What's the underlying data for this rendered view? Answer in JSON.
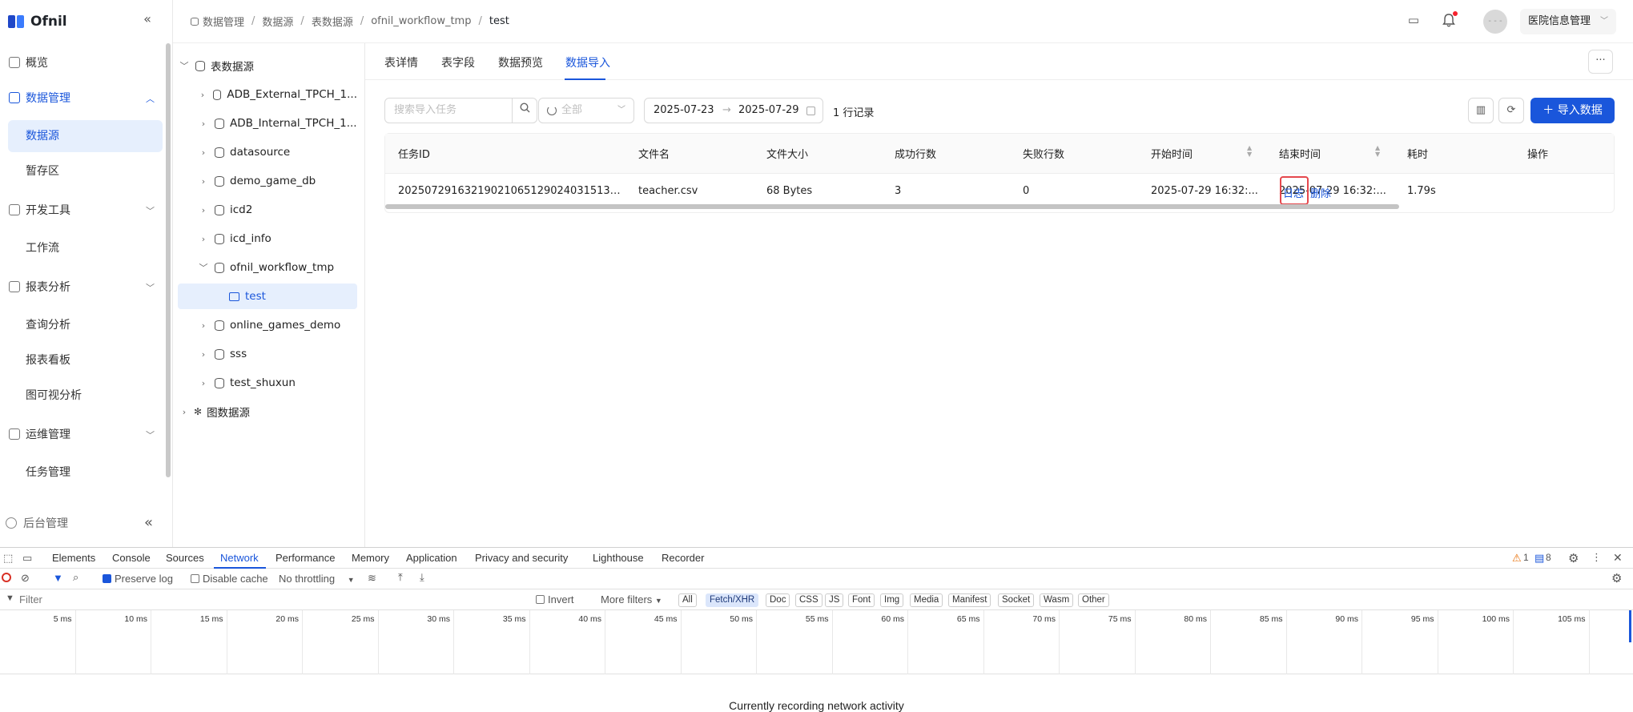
{
  "app": {
    "logo_text": "Ofnil"
  },
  "sidebar": {
    "items": [
      {
        "label": "概览"
      },
      {
        "label": "数据管理"
      },
      {
        "label": "数据源"
      },
      {
        "label": "暂存区"
      },
      {
        "label": "开发工具"
      },
      {
        "label": "工作流"
      },
      {
        "label": "报表分析"
      },
      {
        "label": "查询分析"
      },
      {
        "label": "报表看板"
      },
      {
        "label": "图可视分析"
      },
      {
        "label": "运维管理"
      },
      {
        "label": "任务管理"
      }
    ],
    "bottom_label": "后台管理"
  },
  "breadcrumb": [
    "数据管理",
    "数据源",
    "表数据源",
    "ofnil_workflow_tmp",
    "test"
  ],
  "header": {
    "org_name": "医院信息管理",
    "avatar_text": "- - -"
  },
  "tree": {
    "root": "表数据源",
    "children": [
      "ADB_External_TPCH_1...",
      "ADB_Internal_TPCH_1...",
      "datasource",
      "demo_game_db",
      "icd2",
      "icd_info",
      "ofnil_workflow_tmp",
      "test",
      "online_games_demo",
      "sss",
      "test_shuxun"
    ],
    "graph_root": "图数据源"
  },
  "tabs": [
    "表详情",
    "表字段",
    "数据预览",
    "数据导入"
  ],
  "toolbar": {
    "search_placeholder": "搜索导入任务",
    "status_placeholder": "全部",
    "date_start": "2025-07-23",
    "date_arrow": "→",
    "date_end": "2025-07-29",
    "record_count": "1 行记录",
    "import_label": "导入数据",
    "more_label": "···"
  },
  "table": {
    "columns": [
      "任务ID",
      "文件名",
      "文件大小",
      "成功行数",
      "失败行数",
      "开始时间",
      "结束时间",
      "耗时",
      "操作"
    ],
    "rows": [
      {
        "task_id": "20250729163219021065129024031513…",
        "file_name": "teacher.csv",
        "file_size": "68 Bytes",
        "success_rows": "3",
        "failed_rows": "0",
        "start_time": "2025-07-29 16:32:...",
        "end_time": "2025-07-29 16:32:...",
        "duration": "1.79s",
        "action_log": "日志",
        "action_delete": "删除"
      }
    ]
  },
  "devtools": {
    "tabs": [
      "Elements",
      "Console",
      "Sources",
      "Network",
      "Performance",
      "Memory",
      "Application",
      "Privacy and security",
      "Lighthouse",
      "Recorder"
    ],
    "warnings": "1",
    "messages": "8",
    "preserve_log": "Preserve log",
    "disable_cache": "Disable cache",
    "throttling": "No throttling",
    "filter_placeholder": "Filter",
    "invert": "Invert",
    "more_filters": "More filters",
    "filter_types": [
      "All",
      "Fetch/XHR",
      "Doc",
      "CSS",
      "JS",
      "Font",
      "Img",
      "Media",
      "Manifest",
      "Socket",
      "Wasm",
      "Other"
    ],
    "timeline_labels": [
      "5 ms",
      "10 ms",
      "15 ms",
      "20 ms",
      "25 ms",
      "30 ms",
      "35 ms",
      "40 ms",
      "45 ms",
      "50 ms",
      "55 ms",
      "60 ms",
      "65 ms",
      "70 ms",
      "75 ms",
      "80 ms",
      "85 ms",
      "90 ms",
      "95 ms",
      "100 ms",
      "105 ms"
    ],
    "status_message": "Currently recording network activity"
  }
}
